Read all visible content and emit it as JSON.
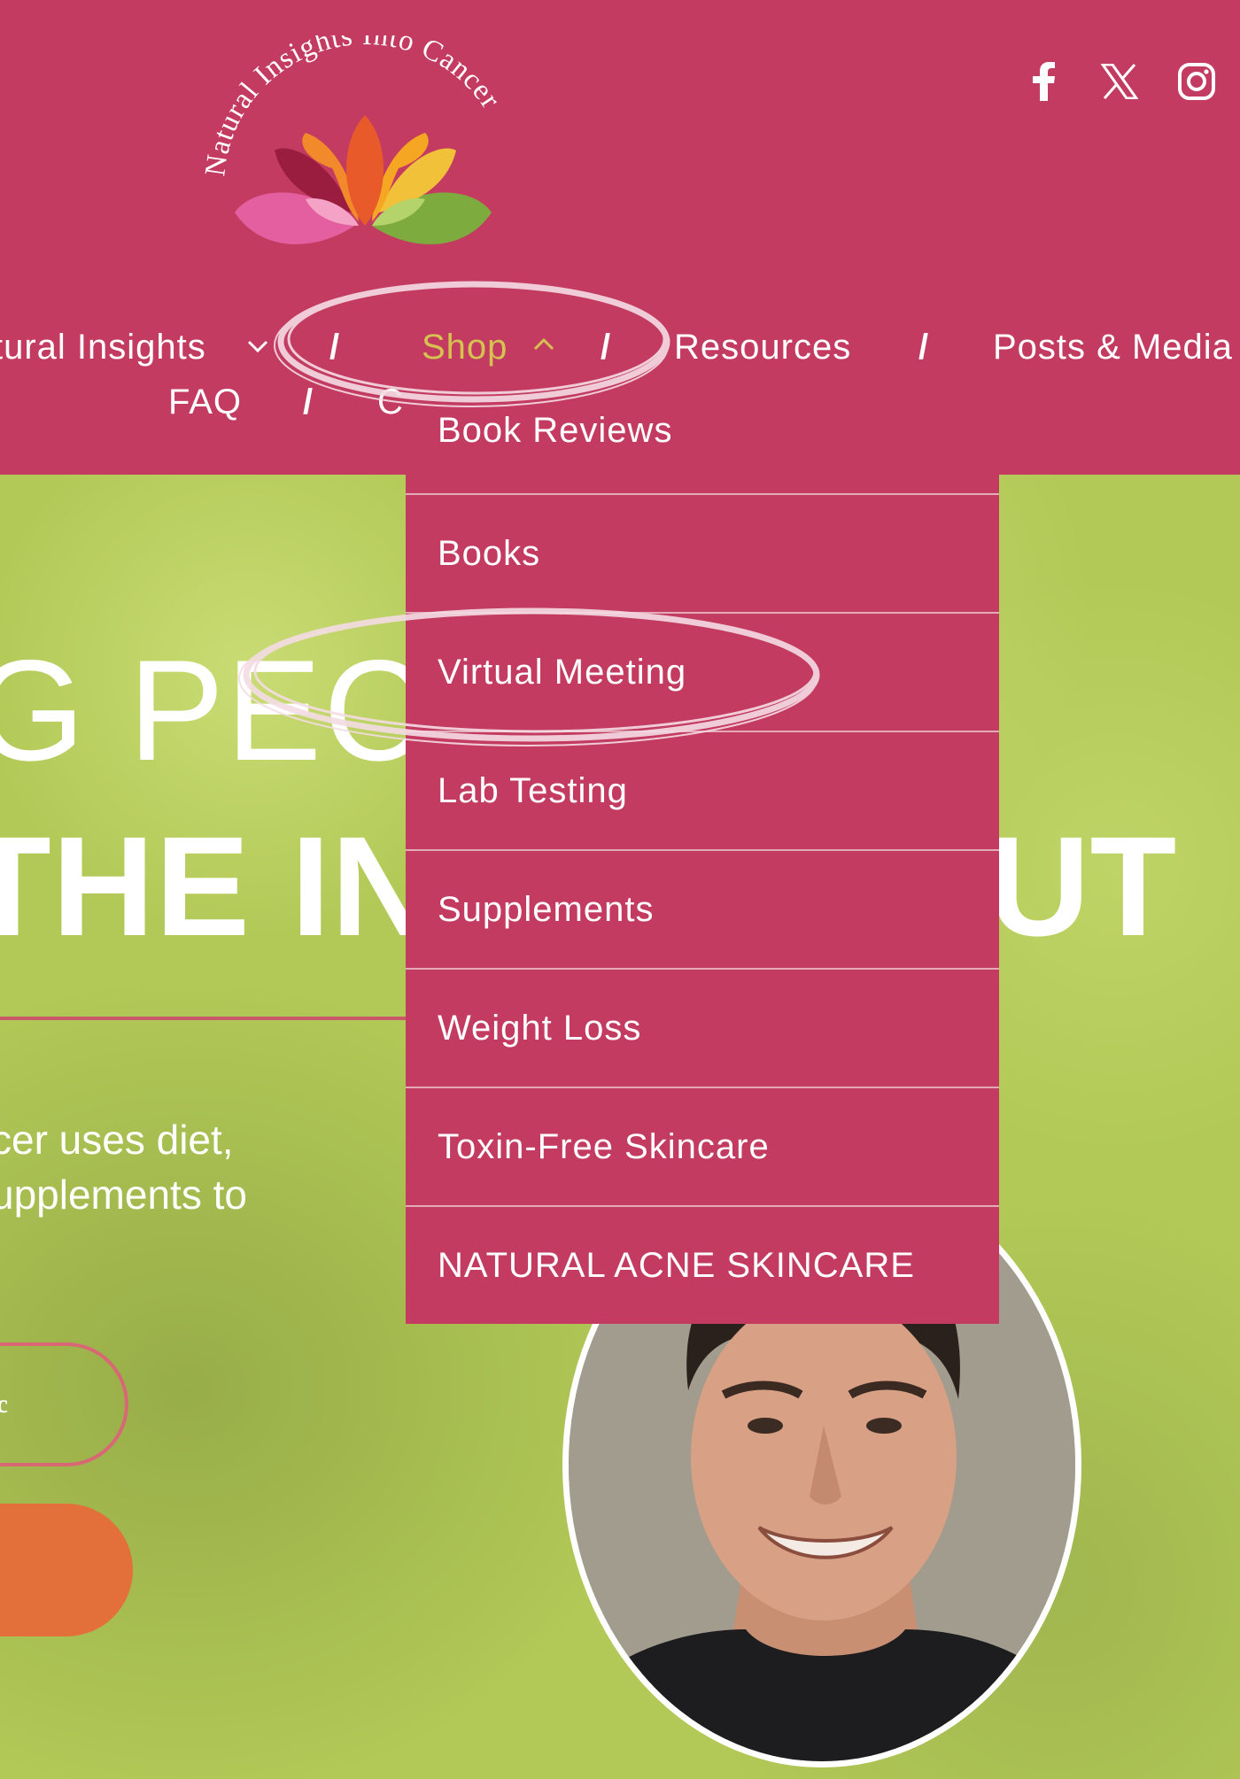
{
  "logo": {
    "text": "Natural Insights Into Cancer"
  },
  "social": [
    "facebook-icon",
    "x-icon",
    "instagram-icon"
  ],
  "nav": {
    "natural_insights": "tural Insights",
    "sep": "/",
    "shop": "Shop",
    "resources": "Resources",
    "posts_media": "Posts & Media",
    "faq": "FAQ",
    "contact_partial": "C"
  },
  "dropdown": [
    "Book Reviews",
    "Books",
    "Virtual Meeting",
    "Lab Testing",
    "Supplements",
    "Weight Loss",
    "Toxin-Free Skincare",
    "NATURAL ACNE SKINCARE"
  ],
  "hero": {
    "line1": "G PEC",
    "line2": "THE IN",
    "line2_end": "UT",
    "text": "cer uses diet,\nupplements to",
    "outline_button": "oc"
  },
  "colors": {
    "brand": "#c33b61",
    "hero_bg": "#b2c957",
    "shop_active": "#d5c250",
    "orange": "#e3703b"
  }
}
